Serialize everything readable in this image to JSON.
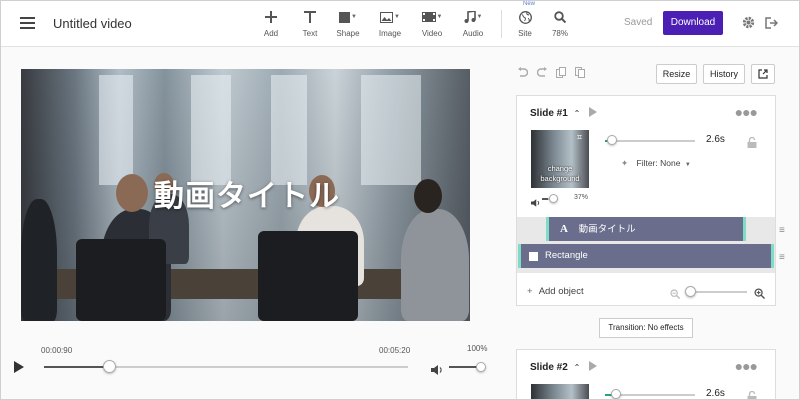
{
  "app": {
    "title": "Untitled video"
  },
  "toolbar": {
    "tools": [
      {
        "label": "Add",
        "icon": "plus-icon"
      },
      {
        "label": "Text",
        "icon": "text-icon"
      },
      {
        "label": "Shape",
        "icon": "shape-icon"
      },
      {
        "label": "Image",
        "icon": "image-icon"
      },
      {
        "label": "Video",
        "icon": "video-icon"
      },
      {
        "label": "Audio",
        "icon": "audio-icon"
      },
      {
        "label": "Site",
        "icon": "globe-icon"
      },
      {
        "label": "78%",
        "icon": "zoom-icon"
      }
    ],
    "new_badge": "New",
    "saved_label": "Saved",
    "download_label": "Download"
  },
  "preview": {
    "overlay_text": "動画タイトル"
  },
  "player": {
    "current_time": "00:00:90",
    "total_time": "00:05:20",
    "volume_label": "100%",
    "progress": 0.18,
    "volume": 1.0
  },
  "editor": {
    "resize_label": "Resize",
    "history_label": "History"
  },
  "slides": [
    {
      "title": "Slide #1",
      "duration": "2.6s",
      "thumb_label_1": "change",
      "thumb_label_2": "background",
      "filter_label": "Filter: None",
      "volume_pct": "37%",
      "duration_fraction": 0.08,
      "volume_fraction": 0.37,
      "layers": [
        {
          "type": "text",
          "label": "動画タイトル",
          "icon_char": "A"
        },
        {
          "type": "shape",
          "label": "Rectangle"
        }
      ],
      "add_object_label": "Add object",
      "transition_label": "Transition: No effects"
    },
    {
      "title": "Slide #2",
      "duration": "2.6s"
    }
  ],
  "colors": {
    "accent": "#4b1fb4",
    "layer_bg": "#6a6e8c",
    "layer_stripe": "#7fdcc5"
  }
}
